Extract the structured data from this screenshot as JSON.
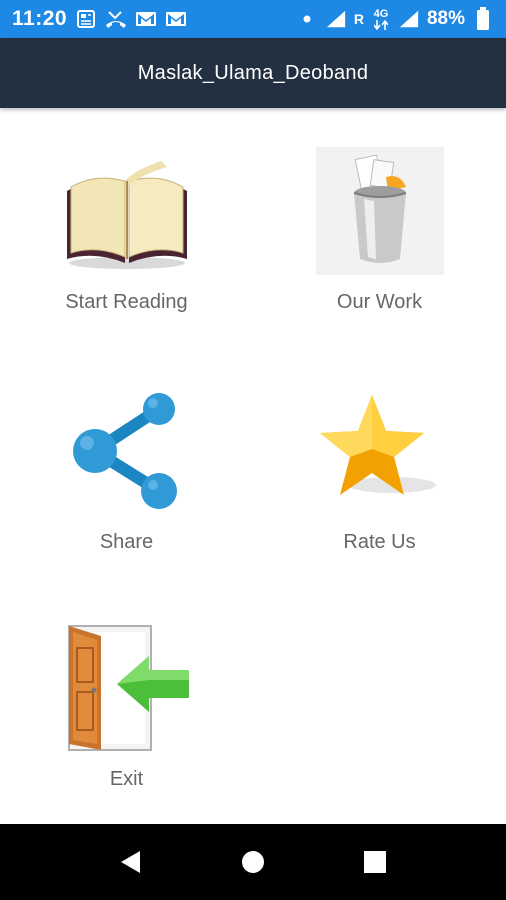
{
  "status_bar": {
    "time": "11:20",
    "network_label": "R",
    "network_type": "4G",
    "battery": "88%",
    "icons": [
      "news-icon",
      "missed-call-icon",
      "gmail-icon",
      "gmail-icon",
      "dot-icon",
      "signal-icon",
      "signal-icon",
      "battery-icon"
    ]
  },
  "app_bar": {
    "title": "Maslak_Ulama_Deoband"
  },
  "menu": {
    "items": [
      {
        "label": "Start Reading",
        "icon": "open-book-icon"
      },
      {
        "label": "Our Work",
        "icon": "paper-bin-icon"
      },
      {
        "label": "Share",
        "icon": "share-icon"
      },
      {
        "label": "Rate Us",
        "icon": "star-icon"
      },
      {
        "label": "Exit",
        "icon": "exit-door-icon"
      }
    ]
  },
  "nav_bar": {
    "buttons": [
      "back-icon",
      "home-icon",
      "recents-icon"
    ]
  },
  "colors": {
    "status_bar": "#1e88e5",
    "app_bar": "#233042",
    "label_text": "#666666"
  }
}
